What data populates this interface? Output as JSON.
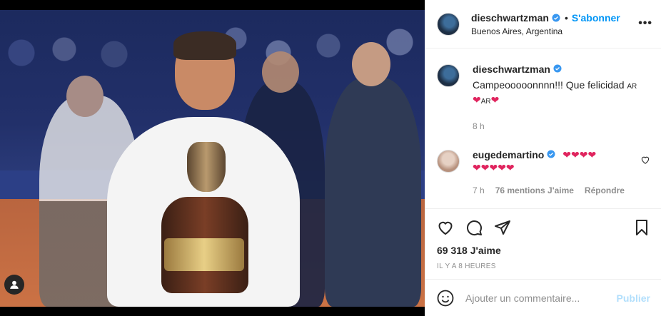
{
  "post": {
    "author": "dieschwartzman",
    "follow_label": "S'abonner",
    "location": "Buenos Aires, Argentina",
    "more_label": "•••"
  },
  "caption": {
    "username": "dieschwartzman",
    "text": "Campeooooonnnn!!! Que felicidad",
    "flag_label": "AR",
    "time": "8 h"
  },
  "comments": [
    {
      "username": "eugedemartino",
      "hearts_line1": "❤❤❤❤",
      "hearts_line2": "❤❤❤❤❤",
      "time": "7 h",
      "likes": "76 mentions J'aime",
      "reply": "Répondre"
    }
  ],
  "likes_count": "69 318 J'aime",
  "posted_ago": "IL Y A 8 HEURES",
  "add_comment": {
    "placeholder": "Ajouter un commentaire...",
    "publish_label": "Publier"
  },
  "icons": {
    "verified": "verified-badge-icon",
    "like": "heart-icon",
    "comment": "comment-bubble-icon",
    "share": "paper-plane-icon",
    "save": "bookmark-icon",
    "emoji": "smiley-icon",
    "tag": "user-tag-icon"
  },
  "colors": {
    "accent": "#0095f6",
    "heart": "#e0245e",
    "muted": "#8e8e8e",
    "publish_disabled": "#b2dffc"
  }
}
